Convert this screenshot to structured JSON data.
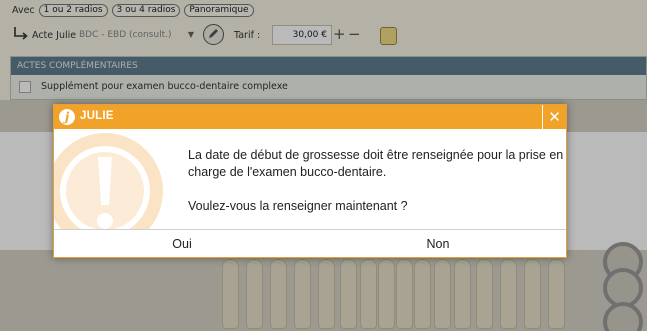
{
  "background": {
    "radio_row": {
      "label": "Avec",
      "options": [
        "1 ou 2 radios",
        "3 ou 4 radios",
        "Panoramique"
      ]
    },
    "acte": {
      "label": "Acte Julie",
      "select_value": "BDC - EBD (consult.)",
      "tarif_label": "Tarif :",
      "tarif_value": "30,00 €"
    },
    "section": {
      "header": "ACTES COMPLÉMENTAIRES",
      "item_label": "Supplément pour examen bucco-dentaire complexe"
    }
  },
  "dialog": {
    "title": "JULIE",
    "logo_letter": "j",
    "accent_color": "#f0a229",
    "icon": "exclamation-icon",
    "message_lines": [
      "La date de début de grossesse doit être renseignée pour la prise en",
      "charge de l'examen bucco-dentaire."
    ],
    "question": "Voulez-vous la renseigner maintenant ?",
    "buttons": {
      "yes": "Oui",
      "no": "Non"
    },
    "close_glyph": "✕"
  }
}
